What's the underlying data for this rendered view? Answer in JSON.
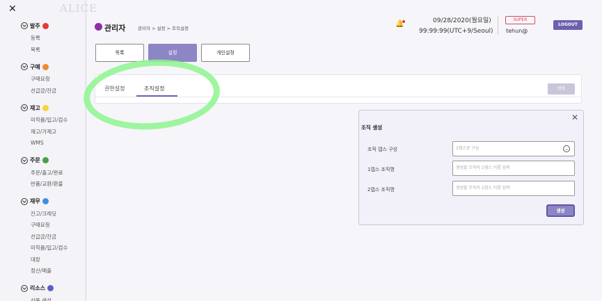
{
  "app": {
    "logo": "ALICE",
    "close_label": "✕"
  },
  "sidebar": {
    "groups": [
      {
        "title": "발주",
        "color": "#e53935",
        "items": [
          "등록",
          "목록"
        ]
      },
      {
        "title": "구매",
        "color": "#f08a2c",
        "items": [
          "구매요청",
          "선급금/잔금"
        ]
      },
      {
        "title": "재고",
        "color": "#f6d43a",
        "items": [
          "미착품/입고/검수",
          "재고/가재고",
          "WMS"
        ]
      },
      {
        "title": "주문",
        "color": "#43a047",
        "items": [
          "주문/출고/완료",
          "반품/교환/환불"
        ]
      },
      {
        "title": "재무",
        "color": "#3f8fe0",
        "items": [
          "잔고/크레딧",
          "구매요청",
          "선급금/잔금",
          "미착품/입고/검수",
          "대장",
          "정산/매출"
        ]
      },
      {
        "title": "리소스",
        "color": "#5c5fbf",
        "items": [
          "상품 생성"
        ]
      }
    ]
  },
  "header": {
    "title": "관리자",
    "breadcrumb": "관리자 > 설정 > 조직설정",
    "date": "09/28/2020(월요일)",
    "time": "99:99:99(UTC+9/Seoul)",
    "role_badge": "SUPER",
    "user": "tehun@",
    "logout_label": "LOGOUT"
  },
  "top_tabs": {
    "list": "목록",
    "settings": "설정",
    "personal": "개인설정",
    "active": "설정"
  },
  "card": {
    "tabs": {
      "permission": "권한설정",
      "organization": "조직설정",
      "active": "조직설정"
    },
    "create_label": "생성"
  },
  "modal": {
    "title": "조직 생성",
    "close_label": "✕",
    "fields": [
      {
        "label": "조직 뎁스 구성",
        "placeholder": "2뎁스로 구성"
      },
      {
        "label": "1뎁스 조직명",
        "placeholder": "생성할 조직의 1뎁스 이름 입력"
      },
      {
        "label": "2뎁스 조직명",
        "placeholder": "생성할 조직의 2뎁스 이름 입력"
      }
    ],
    "create_label": "생성"
  },
  "colors": {
    "accent": "#8d86c4",
    "logout": "#6e5fb0",
    "highlight": "#8ef58e"
  }
}
